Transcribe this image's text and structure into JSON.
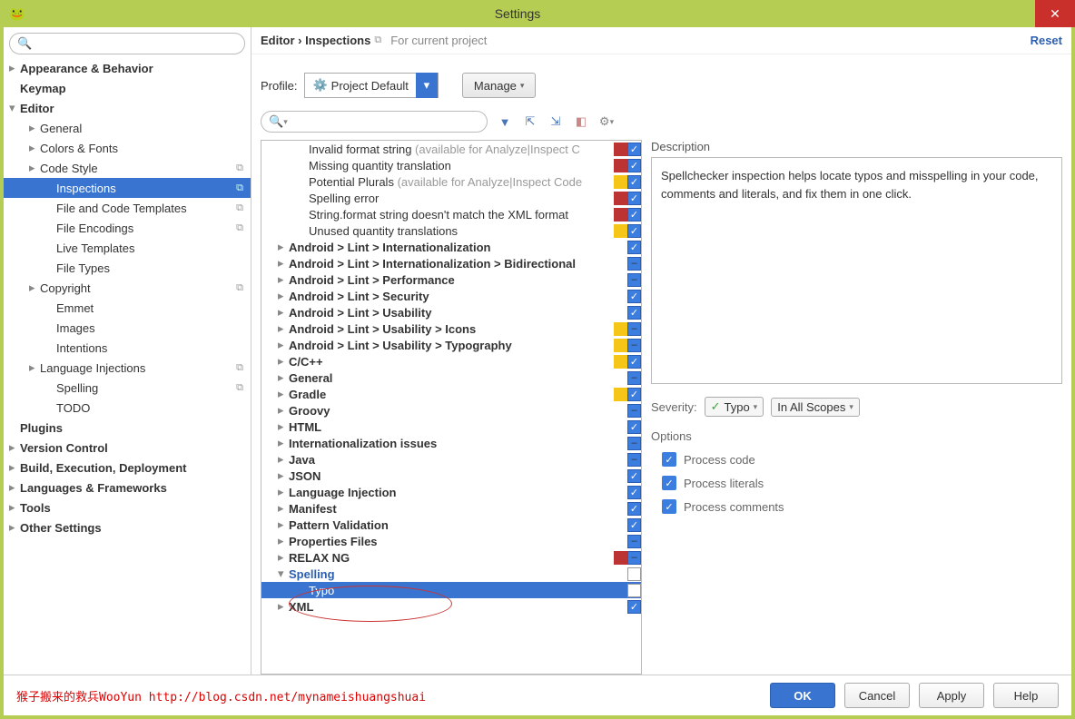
{
  "window": {
    "title": "Settings"
  },
  "header": {
    "breadcrumb": "Editor › Inspections",
    "scope": "For current project",
    "reset": "Reset"
  },
  "sidebar": {
    "items": [
      {
        "label": "Appearance & Behavior",
        "bold": true,
        "arrow": "▸",
        "indent": 0
      },
      {
        "label": "Keymap",
        "bold": true,
        "indent": 0
      },
      {
        "label": "Editor",
        "bold": true,
        "arrow": "▾",
        "indent": 0
      },
      {
        "label": "General",
        "arrow": "▸",
        "indent": 1
      },
      {
        "label": "Colors & Fonts",
        "arrow": "▸",
        "indent": 1
      },
      {
        "label": "Code Style",
        "arrow": "▸",
        "indent": 1,
        "copy": true
      },
      {
        "label": "Inspections",
        "indent": 2,
        "selected": true,
        "copy": true
      },
      {
        "label": "File and Code Templates",
        "indent": 2,
        "copy": true
      },
      {
        "label": "File Encodings",
        "indent": 2,
        "copy": true
      },
      {
        "label": "Live Templates",
        "indent": 2
      },
      {
        "label": "File Types",
        "indent": 2
      },
      {
        "label": "Copyright",
        "arrow": "▸",
        "indent": 1,
        "copy": true
      },
      {
        "label": "Emmet",
        "indent": 2
      },
      {
        "label": "Images",
        "indent": 2
      },
      {
        "label": "Intentions",
        "indent": 2
      },
      {
        "label": "Language Injections",
        "arrow": "▸",
        "indent": 1,
        "copy": true
      },
      {
        "label": "Spelling",
        "indent": 2,
        "copy": true
      },
      {
        "label": "TODO",
        "indent": 2
      },
      {
        "label": "Plugins",
        "bold": true,
        "indent": 0
      },
      {
        "label": "Version Control",
        "bold": true,
        "arrow": "▸",
        "indent": 0
      },
      {
        "label": "Build, Execution, Deployment",
        "bold": true,
        "arrow": "▸",
        "indent": 0
      },
      {
        "label": "Languages & Frameworks",
        "bold": true,
        "arrow": "▸",
        "indent": 0
      },
      {
        "label": "Tools",
        "bold": true,
        "arrow": "▸",
        "indent": 0
      },
      {
        "label": "Other Settings",
        "bold": true,
        "arrow": "▸",
        "indent": 0
      }
    ]
  },
  "profile": {
    "label": "Profile:",
    "value": "Project Default",
    "manage": "Manage"
  },
  "inspections": [
    {
      "txt": "Invalid format string",
      "gray": "(available for Analyze|Inspect C",
      "sq": "red",
      "chk": "tick",
      "indent": 1
    },
    {
      "txt": "Missing quantity translation",
      "sq": "red",
      "chk": "tick",
      "indent": 1
    },
    {
      "txt": "Potential Plurals",
      "gray": "(available for Analyze|Inspect Code",
      "sq": "yellow",
      "chk": "tick",
      "indent": 1
    },
    {
      "txt": "Spelling error",
      "sq": "red",
      "chk": "tick",
      "indent": 1
    },
    {
      "txt": "String.format string doesn't match the XML format",
      "sq": "red",
      "chk": "tick",
      "indent": 1
    },
    {
      "txt": "Unused quantity translations",
      "sq": "yellow",
      "chk": "tick",
      "indent": 1
    },
    {
      "txt": "Android > Lint > Internationalization",
      "bold": true,
      "arrow": "▸",
      "chk": "tick",
      "indent": 0
    },
    {
      "txt": "Android > Lint > Internationalization > Bidirectional",
      "bold": true,
      "arrow": "▸",
      "chk": "dash",
      "indent": 0
    },
    {
      "txt": "Android > Lint > Performance",
      "bold": true,
      "arrow": "▸",
      "chk": "dash",
      "indent": 0
    },
    {
      "txt": "Android > Lint > Security",
      "bold": true,
      "arrow": "▸",
      "chk": "tick",
      "indent": 0
    },
    {
      "txt": "Android > Lint > Usability",
      "bold": true,
      "arrow": "▸",
      "chk": "tick",
      "indent": 0
    },
    {
      "txt": "Android > Lint > Usability > Icons",
      "bold": true,
      "arrow": "▸",
      "sq": "yellow",
      "chk": "dash",
      "indent": 0
    },
    {
      "txt": "Android > Lint > Usability > Typography",
      "bold": true,
      "arrow": "▸",
      "sq": "yellow",
      "chk": "dash",
      "indent": 0
    },
    {
      "txt": "C/C++",
      "bold": true,
      "arrow": "▸",
      "sq": "yellow",
      "chk": "tick",
      "indent": 0
    },
    {
      "txt": "General",
      "bold": true,
      "arrow": "▸",
      "chk": "dash",
      "indent": 0
    },
    {
      "txt": "Gradle",
      "bold": true,
      "arrow": "▸",
      "sq": "yellow",
      "chk": "tick",
      "indent": 0
    },
    {
      "txt": "Groovy",
      "bold": true,
      "arrow": "▸",
      "chk": "dash",
      "indent": 0
    },
    {
      "txt": "HTML",
      "bold": true,
      "arrow": "▸",
      "chk": "tick",
      "indent": 0
    },
    {
      "txt": "Internationalization issues",
      "bold": true,
      "arrow": "▸",
      "chk": "dash",
      "indent": 0
    },
    {
      "txt": "Java",
      "bold": true,
      "arrow": "▸",
      "chk": "dash",
      "indent": 0
    },
    {
      "txt": "JSON",
      "bold": true,
      "arrow": "▸",
      "chk": "tick",
      "indent": 0
    },
    {
      "txt": "Language Injection",
      "bold": true,
      "arrow": "▸",
      "chk": "tick",
      "indent": 0
    },
    {
      "txt": "Manifest",
      "bold": true,
      "arrow": "▸",
      "chk": "tick",
      "indent": 0
    },
    {
      "txt": "Pattern Validation",
      "bold": true,
      "arrow": "▸",
      "chk": "tick",
      "indent": 0
    },
    {
      "txt": "Properties Files",
      "bold": true,
      "arrow": "▸",
      "chk": "dash",
      "indent": 0
    },
    {
      "txt": "RELAX NG",
      "bold": true,
      "arrow": "▸",
      "sq": "red",
      "chk": "dash",
      "indent": 0
    },
    {
      "txt": "Spelling",
      "bold": true,
      "arrow": "▾",
      "blue": true,
      "chk": "flat",
      "indent": 0
    },
    {
      "txt": "Typo",
      "sel": true,
      "chk": "flat",
      "indent": 1
    },
    {
      "txt": "XML",
      "bold": true,
      "arrow": "▸",
      "chk": "tick",
      "indent": 0
    }
  ],
  "description": {
    "label": "Description",
    "text": "Spellchecker inspection helps locate typos and misspelling in your code, comments and literals, and fix them in one click."
  },
  "severity": {
    "label": "Severity:",
    "value": "Typo",
    "scope": "In All Scopes"
  },
  "options": {
    "label": "Options",
    "items": [
      {
        "label": "Process code",
        "checked": true
      },
      {
        "label": "Process literals",
        "checked": true
      },
      {
        "label": "Process comments",
        "checked": true
      }
    ]
  },
  "footer": {
    "attribution": "猴子搬来的救兵WooYun http://blog.csdn.net/mynameishuangshuai",
    "ok": "OK",
    "cancel": "Cancel",
    "apply": "Apply",
    "help": "Help"
  }
}
